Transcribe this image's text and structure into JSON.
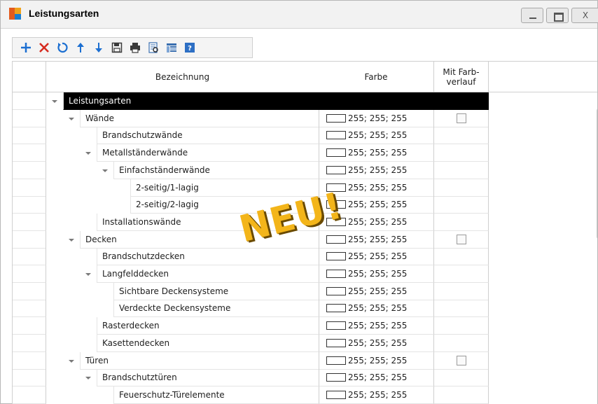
{
  "window": {
    "title": "Leistungsarten",
    "controls": {
      "minimize": "",
      "maximize": "",
      "close": "X"
    }
  },
  "toolbar": {
    "buttons": [
      {
        "icon": "plus-icon",
        "color": "#1c6fd1"
      },
      {
        "icon": "delete-icon",
        "color": "#d62b1f"
      },
      {
        "icon": "refresh-icon",
        "color": "#1c6fd1"
      },
      {
        "icon": "arrow-up-icon",
        "color": "#1c6fd1"
      },
      {
        "icon": "arrow-down-icon",
        "color": "#1c6fd1"
      },
      {
        "icon": "save-icon",
        "color": "#3a3a3a"
      },
      {
        "icon": "print-icon",
        "color": "#3a3a3a"
      },
      {
        "icon": "preview-icon",
        "color": "#3a6fb0"
      },
      {
        "icon": "columns-icon",
        "color": "#3a6fb0"
      },
      {
        "icon": "help-icon",
        "color": "#2d6fc4"
      }
    ]
  },
  "grid": {
    "columns": [
      "Bezeichnung",
      "Farbe",
      "Mit Farb-\nverlauf"
    ],
    "rows": [
      {
        "name": "Leistungsarten",
        "level": 0,
        "expanded": true,
        "color": "",
        "checkbox": false,
        "selected": true
      },
      {
        "name": "Wände",
        "level": 1,
        "expanded": true,
        "color": "255; 255; 255",
        "checkbox": true
      },
      {
        "name": "Brandschutzwände",
        "level": 2,
        "color": "255; 255; 255",
        "checkbox": false
      },
      {
        "name": "Metallständerwände",
        "level": 2,
        "expanded": true,
        "color": "255; 255; 255",
        "checkbox": false
      },
      {
        "name": "Einfachständerwände",
        "level": 3,
        "expanded": true,
        "color": "255; 255; 255",
        "checkbox": false
      },
      {
        "name": "2-seitig/1-lagig",
        "level": 4,
        "color": "255; 255; 255",
        "checkbox": false
      },
      {
        "name": "2-seitig/2-lagig",
        "level": 4,
        "color": "255; 255; 255",
        "checkbox": false
      },
      {
        "name": "Installationswände",
        "level": 2,
        "color": "255; 255; 255",
        "checkbox": false
      },
      {
        "name": "Decken",
        "level": 1,
        "expanded": true,
        "color": "255; 255; 255",
        "checkbox": true
      },
      {
        "name": "Brandschutzdecken",
        "level": 2,
        "color": "255; 255; 255",
        "checkbox": false
      },
      {
        "name": "Langfelddecken",
        "level": 2,
        "expanded": true,
        "color": "255; 255; 255",
        "checkbox": false
      },
      {
        "name": "Sichtbare Deckensysteme",
        "level": 3,
        "color": "255; 255; 255",
        "checkbox": false
      },
      {
        "name": "Verdeckte Deckensysteme",
        "level": 3,
        "color": "255; 255; 255",
        "checkbox": false
      },
      {
        "name": "Rasterdecken",
        "level": 2,
        "color": "255; 255; 255",
        "checkbox": false
      },
      {
        "name": "Kasettendecken",
        "level": 2,
        "color": "255; 255; 255",
        "checkbox": false
      },
      {
        "name": "Türen",
        "level": 1,
        "expanded": true,
        "color": "255; 255; 255",
        "checkbox": true
      },
      {
        "name": "Brandschutztüren",
        "level": 2,
        "expanded": true,
        "color": "255; 255; 255",
        "checkbox": false
      },
      {
        "name": "Feuerschutz-Türelemente",
        "level": 3,
        "color": "255; 255; 255",
        "checkbox": false
      }
    ]
  },
  "stamp": {
    "text": "NEU!",
    "color": "#f3b51a"
  }
}
